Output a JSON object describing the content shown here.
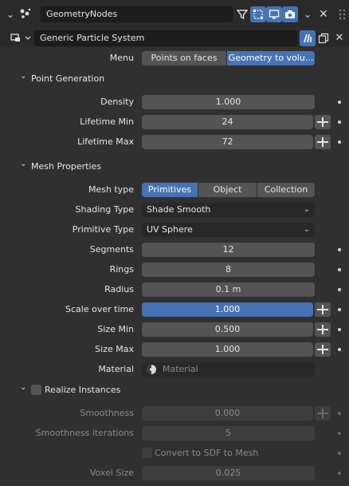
{
  "header": {
    "modifier_name": "GeometryNodes",
    "menu_chevron": "chevron-down-icon",
    "node_group": "Generic Particle System"
  },
  "menu": {
    "label": "Menu",
    "options": [
      "Points on faces",
      "Geometry to volu..."
    ],
    "active_index": 1
  },
  "point_generation": {
    "title": "Point Generation",
    "density": {
      "label": "Density",
      "value": "1.000"
    },
    "lifetime_min": {
      "label": "Lifetime Min",
      "value": "24"
    },
    "lifetime_max": {
      "label": "Lifetime Max",
      "value": "72"
    }
  },
  "mesh_properties": {
    "title": "Mesh Properties",
    "mesh_type": {
      "label": "Mesh type",
      "options": [
        "Primitives",
        "Object",
        "Collection"
      ],
      "active_index": 0
    },
    "shading_type": {
      "label": "Shading Type",
      "value": "Shade Smooth"
    },
    "primitive_type": {
      "label": "Primitive Type",
      "value": "UV Sphere"
    },
    "segments": {
      "label": "Segments",
      "value": "12"
    },
    "rings": {
      "label": "Rings",
      "value": "8"
    },
    "radius": {
      "label": "Radius",
      "value": "0.1 m"
    },
    "scale_over_time": {
      "label": "Scale over time",
      "value": "1.000"
    },
    "size_min": {
      "label": "Size Min",
      "value": "0.500"
    },
    "size_max": {
      "label": "Size Max",
      "value": "1.000"
    },
    "material": {
      "label": "Material",
      "placeholder": "Material"
    }
  },
  "realize_instances": {
    "title": "Realize Instances",
    "checked": false,
    "smoothness": {
      "label": "Smoothness",
      "value": "0.000"
    },
    "smoothness_iterations": {
      "label": "Smoothness iterations",
      "value": "5"
    },
    "convert_sdf": {
      "label": "Convert to SDF to Mesh"
    },
    "voxel_size": {
      "label": "Voxel Size",
      "value": "0.025"
    }
  },
  "colors": {
    "accent": "#4772b3",
    "panel": "#303030",
    "field": "#545454"
  }
}
